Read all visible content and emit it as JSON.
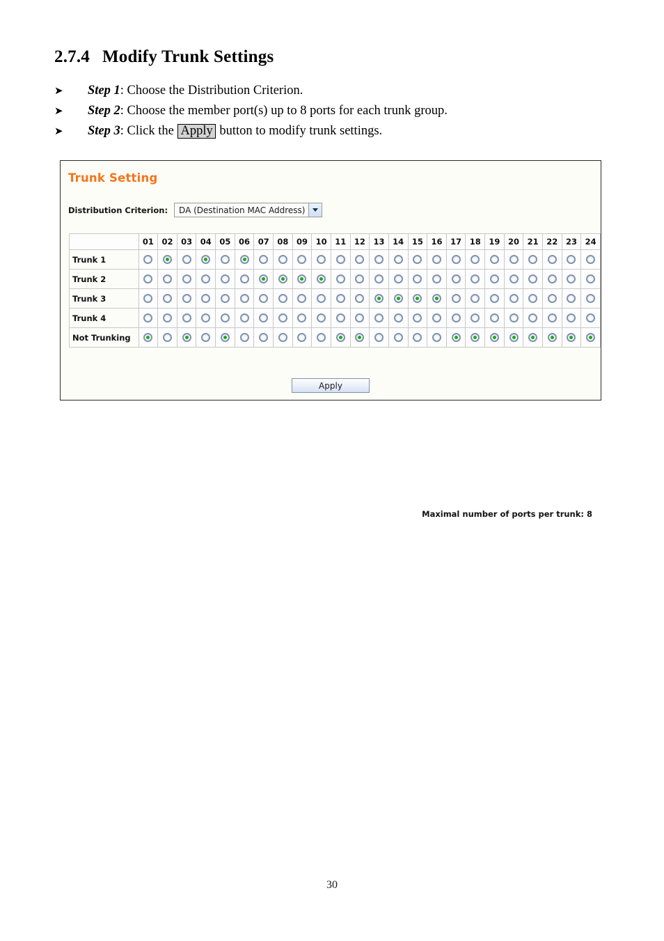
{
  "document": {
    "heading_number": "2.7.4",
    "heading_title": "Modify Trunk Settings",
    "page_number": "30",
    "bullet_glyph": "➤",
    "steps": [
      {
        "label": "Step 1",
        "text_before": ": Choose the Distribution Criterion.",
        "inline_button": "",
        "text_after": ""
      },
      {
        "label": "Step 2",
        "text_before": ": Choose the member port(s) up to 8 ports for each trunk group.",
        "inline_button": "",
        "text_after": ""
      },
      {
        "label": "Step 3",
        "text_before": ": Click the ",
        "inline_button": "Apply",
        "text_after": " button to modify trunk settings."
      }
    ]
  },
  "panel": {
    "title": "Trunk Setting",
    "criterion_label": "Distribution Criterion:",
    "criterion_value": "DA (Destination MAC Address)",
    "criterion_options": [
      "DA (Destination MAC Address)"
    ],
    "max_ports_note": "Maximal number of ports per trunk: 8",
    "apply_label": "Apply",
    "title_color": "#f4751c",
    "selected_dot_color": "#1da81d",
    "radio_ring_color": "#7d93b2"
  },
  "table": {
    "port_headers": [
      "01",
      "02",
      "03",
      "04",
      "05",
      "06",
      "07",
      "08",
      "09",
      "10",
      "11",
      "12",
      "13",
      "14",
      "15",
      "16",
      "17",
      "18",
      "19",
      "20",
      "21",
      "22",
      "23",
      "24"
    ],
    "rows": [
      {
        "label": "Trunk 1",
        "selected_ports": [
          2,
          4,
          6
        ]
      },
      {
        "label": "Trunk 2",
        "selected_ports": [
          7,
          8,
          9,
          10
        ]
      },
      {
        "label": "Trunk 3",
        "selected_ports": [
          13,
          14,
          15,
          16
        ]
      },
      {
        "label": "Trunk 4",
        "selected_ports": []
      },
      {
        "label": "Not Trunking",
        "selected_ports": [
          1,
          3,
          5,
          11,
          12,
          17,
          18,
          19,
          20,
          21,
          22,
          23,
          24
        ]
      }
    ]
  }
}
